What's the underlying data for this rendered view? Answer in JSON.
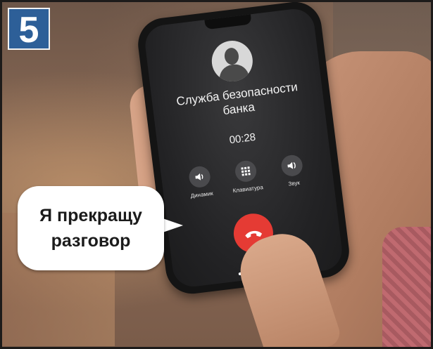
{
  "step": {
    "number": "5"
  },
  "phone": {
    "caller_name": "Служба безопасности банка",
    "call_timer": "00:28",
    "controls": [
      {
        "label": "Динамик",
        "icon": "speaker-icon"
      },
      {
        "label": "Клавиатура",
        "icon": "keypad-icon"
      },
      {
        "label": "Звук",
        "icon": "sound-icon"
      }
    ],
    "end_call_icon": "hang-up-icon"
  },
  "bubble": {
    "line1": "Я прекращу",
    "line2": "разговор"
  },
  "colors": {
    "badge": "#2d5f98",
    "end_call": "#e53b34",
    "screen": "#222224"
  }
}
